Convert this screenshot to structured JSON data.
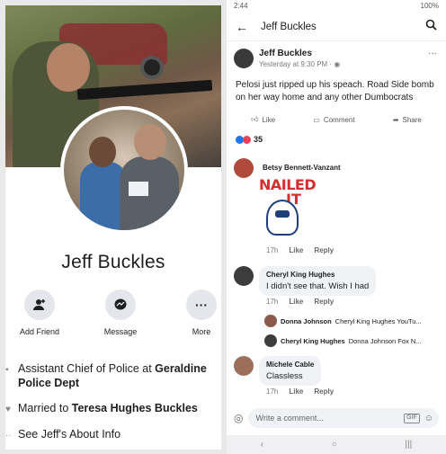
{
  "left": {
    "name": "Jeff Buckles",
    "actions": [
      {
        "label": "Add Friend",
        "icon": "add-friend-icon"
      },
      {
        "label": "Message",
        "icon": "messenger-icon"
      },
      {
        "label": "More",
        "icon": "more-icon"
      }
    ],
    "info": {
      "work_pre": "Assistant Chief of Police at ",
      "work_org": "Geraldine Police Dept",
      "married_pre": "Married to ",
      "married_name": "Teresa Hughes Buckles",
      "about": "See Jeff's About Info"
    }
  },
  "right": {
    "status": {
      "time": "2:44",
      "right": "100%"
    },
    "header": {
      "title": "Jeff Buckles"
    },
    "post": {
      "author": "Jeff Buckles",
      "timestamp": "Yesterday at 9:30 PM · ",
      "text": "Pelosi just ripped up his speach. Road Side bomb on her way home and any other Dumbocrats",
      "like": "Like",
      "comment": "Comment",
      "share": "Share",
      "reaction_count": "35"
    },
    "comments": [
      {
        "name": "Betsy Bennett-Vanzant",
        "sticker_line1": "NAILED",
        "sticker_line2": "IT",
        "age": "17h",
        "like": "Like",
        "reply": "Reply"
      },
      {
        "name": "Cheryl King Hughes",
        "text": "I didn't see that. Wish I had",
        "age": "17h",
        "like": "Like",
        "reply": "Reply"
      },
      {
        "name": "Michele Cable",
        "text": "Classless",
        "age": "17h",
        "like": "Like",
        "reply": "Reply"
      }
    ],
    "replies": [
      {
        "name": "Donna Johnson",
        "text": "Cheryl King Hughes YouTu..."
      },
      {
        "name": "Cheryl King Hughes",
        "text": "Donna Johnson Fox N..."
      }
    ],
    "composer": {
      "placeholder": "Write a comment..."
    }
  },
  "colors": {
    "like_blue": "#1877f2",
    "love_red": "#f33e58",
    "sticker_red": "#d32f2f"
  }
}
